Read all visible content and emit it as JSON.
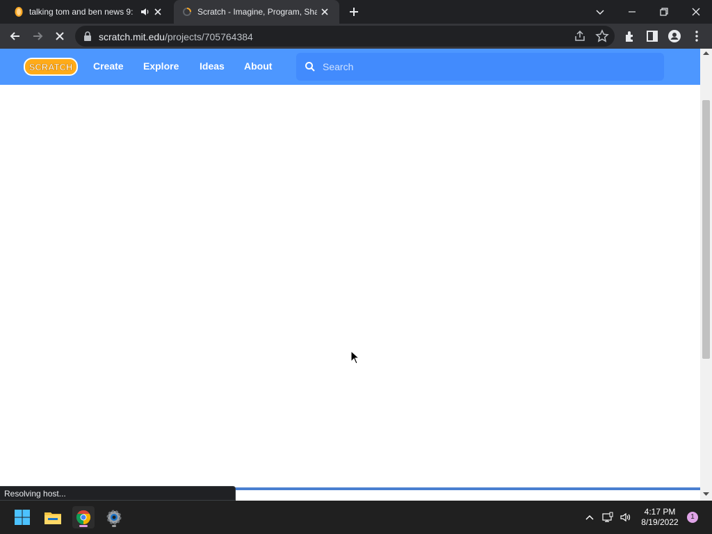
{
  "browser": {
    "tabs": [
      {
        "title": "talking tom and ben news 9:",
        "active": false,
        "favicon": "scratch-favicon",
        "audio": true
      },
      {
        "title": "Scratch - Imagine, Program, Share",
        "active": true,
        "favicon": "loading-favicon",
        "audio": false
      }
    ],
    "url_host": "scratch.mit.edu",
    "url_path": "/projects/705764384",
    "status_text": "Resolving host..."
  },
  "scratch": {
    "logo_text": "SCRATCH",
    "nav": [
      "Create",
      "Explore",
      "Ideas",
      "About"
    ],
    "search_placeholder": "Search"
  },
  "taskbar": {
    "time": "4:17 PM",
    "date": "8/19/2022",
    "notification_count": "1"
  },
  "colors": {
    "scratch_blue": "#4d97ff",
    "chrome_dark": "#202124",
    "chrome_toolbar": "#35363a",
    "taskbar": "#202020"
  }
}
